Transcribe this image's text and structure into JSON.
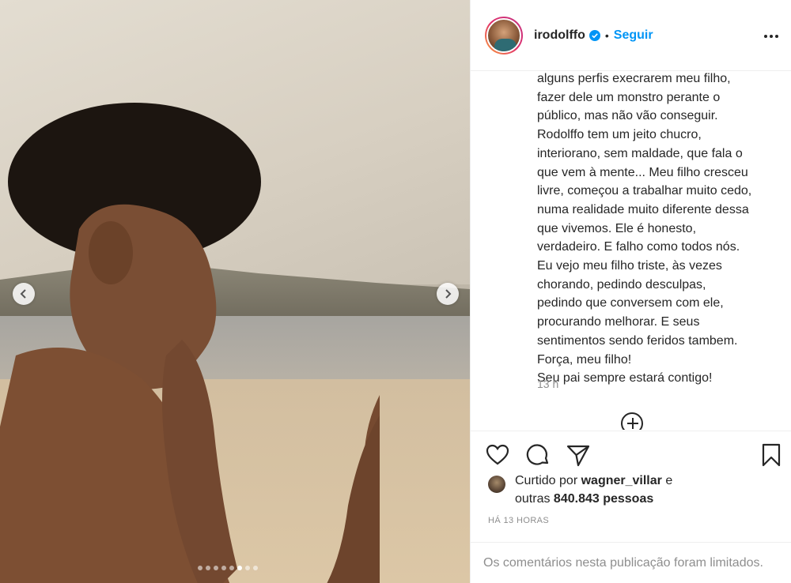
{
  "post": {
    "carousel": {
      "slide_count": 8,
      "active_index": 5
    }
  },
  "header": {
    "username": "irodolffo",
    "separator": "•",
    "follow_label": "Seguir"
  },
  "caption": {
    "lines": [
      "alguns perfis execrarem meu filho,",
      "fazer dele um monstro perante o",
      "público, mas não vão conseguir.",
      "Rodolffo tem um jeito chucro,",
      "interiorano, sem maldade, que fala o",
      "que vem à mente... Meu filho cresceu",
      "livre, começou a trabalhar muito cedo,",
      "numa realidade muito diferente dessa",
      "que vivemos. Ele é honesto,",
      "verdadeiro. E falho como todos nós.",
      "Eu vejo meu filho triste, às vezes",
      "chorando, pedindo desculpas,",
      "pedindo que conversem com ele,",
      "procurando melhorar. E seus",
      "sentimentos sendo feridos tambem.",
      "Força, meu filho!",
      "Seu pai sempre estará contigo!"
    ],
    "time": "13 h"
  },
  "likes": {
    "prefix": "Curtido por ",
    "user": "wagner_villar",
    "suffix": " e",
    "line2_prefix": "outras ",
    "count": "840.843 pessoas"
  },
  "timestamp": "HÁ 13 HORAS",
  "comments_notice": "Os comentários nesta publicação foram limitados.",
  "colors": {
    "accent": "#0095f6",
    "text": "#262626",
    "muted": "#8e8e8e",
    "border": "#efefef"
  }
}
